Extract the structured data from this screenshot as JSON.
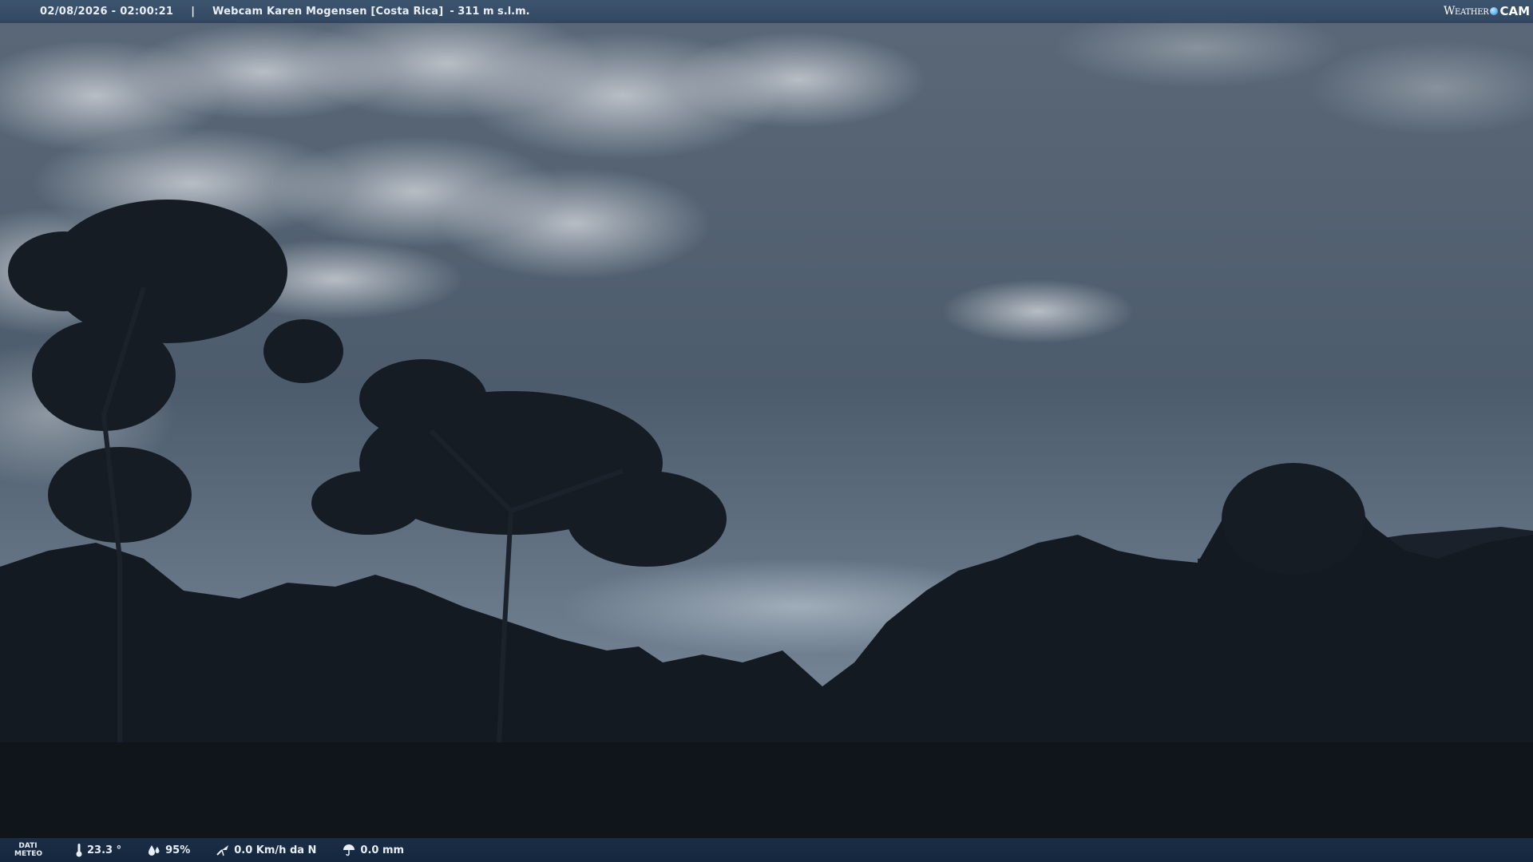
{
  "header": {
    "timestamp": "02/08/2026 - 02:00:21",
    "separator": "|",
    "title": "Webcam Karen Mogensen [Costa Rica]",
    "altitude": "- 311 m s.l.m."
  },
  "logo": {
    "word": "Weather",
    "suffix": "CAM"
  },
  "footer": {
    "dati_line1": "DATI",
    "dati_line2": "METEO",
    "temperature": "23.3 °",
    "humidity": "95%",
    "wind": "0.0 Km/h da N",
    "rain": "0.0 mm"
  },
  "icons": {
    "temperature": "thermometer-icon",
    "humidity": "droplets-icon",
    "wind": "wind-icon",
    "rain": "umbrella-icon"
  },
  "colors": {
    "header_bg": "#3a526e",
    "footer_bg": "#1c304a",
    "text": "#e8eef6"
  }
}
